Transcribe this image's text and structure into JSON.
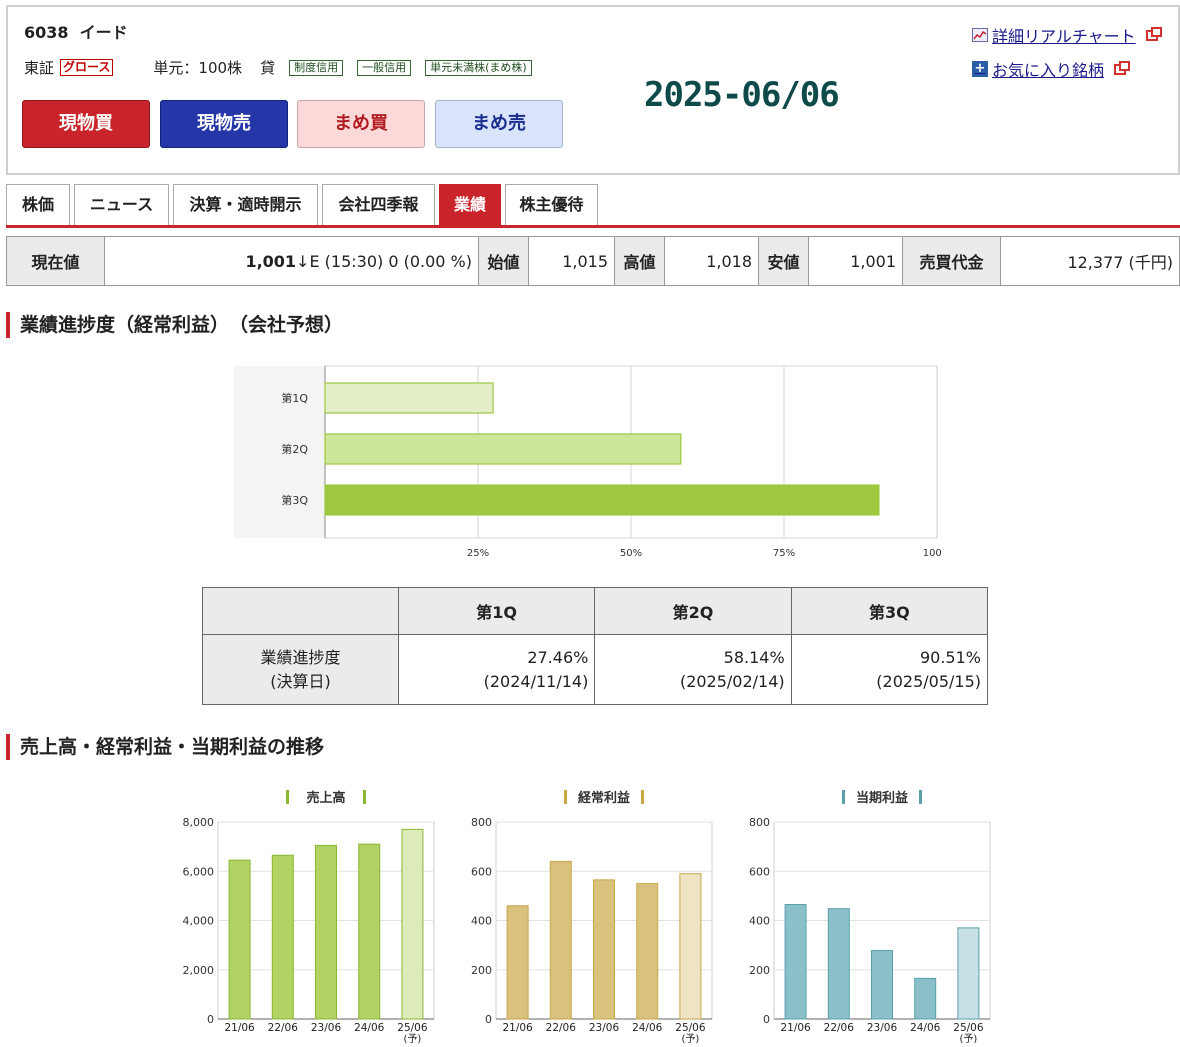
{
  "header": {
    "code": "6038",
    "name": "イード",
    "market": "東証",
    "market_badge": "グロース",
    "unit": "単元：100株",
    "kashi": "貸",
    "tags": [
      "制度信用",
      "一般信用",
      "単元未満株(まめ株)"
    ],
    "date": "2025-06/06",
    "links": [
      "詳細リアルチャート",
      "お気に入り銘柄"
    ],
    "buttons": [
      "現物買",
      "現物売",
      "まめ買",
      "まめ売"
    ]
  },
  "tabs": [
    {
      "label": "株価",
      "active": false
    },
    {
      "label": "ニュース",
      "active": false
    },
    {
      "label": "決算・適時開示",
      "active": false
    },
    {
      "label": "会社四季報",
      "active": false
    },
    {
      "label": "業績",
      "active": true
    },
    {
      "label": "株主優待",
      "active": false
    }
  ],
  "price": {
    "current_label": "現在値",
    "current_price": "1,001",
    "current_arrow": "↓",
    "current_detail": "E (15:30) 0 (0.00 %)",
    "open_label": "始値",
    "open": "1,015",
    "high_label": "高値",
    "high": "1,018",
    "low_label": "安値",
    "low": "1,001",
    "volume_label": "売買代金",
    "volume": "12,377 (千円)"
  },
  "sections": {
    "progress_title": "業績進捗度（経常利益）　（会社予想）",
    "trend_title": "売上高・経常利益・当期利益の推移"
  },
  "progress_table": {
    "headers": [
      "",
      "第1Q",
      "第2Q",
      "第3Q"
    ],
    "row_label": [
      "業績進捗度",
      "(決算日)"
    ],
    "values": [
      "27.46%",
      "58.14%",
      "90.51%"
    ],
    "dates": [
      "(2024/11/14)",
      "(2025/02/14)",
      "(2025/05/15)"
    ]
  },
  "chart_data": [
    {
      "type": "bar",
      "orientation": "horizontal",
      "categories": [
        "第1Q",
        "第2Q",
        "第3Q"
      ],
      "values": [
        27.46,
        58.14,
        90.51
      ],
      "xlim": [
        0,
        100
      ],
      "xticks": [
        "25%",
        "50%",
        "75%",
        "100%"
      ],
      "colors": [
        "#e2efc8",
        "#cde69c",
        "#9dc83f"
      ],
      "grid": true
    },
    {
      "type": "bar",
      "title": "売上高",
      "categories": [
        "21/06",
        "22/06",
        "23/06",
        "24/06",
        "25/06"
      ],
      "forecast_label": "(予)",
      "values": [
        6450,
        6650,
        7050,
        7100,
        7700
      ],
      "ylim": [
        0,
        8000
      ],
      "ytick_values": [
        0,
        2000,
        4000,
        6000,
        8000
      ],
      "yticks": [
        "0",
        "2,000",
        "4,000",
        "6,000",
        "8,000"
      ],
      "color": "#b2d263",
      "forecast_color": "#dcebb8",
      "accent": "#8ab832"
    },
    {
      "type": "bar",
      "title": "経常利益",
      "categories": [
        "21/06",
        "22/06",
        "23/06",
        "24/06",
        "25/06"
      ],
      "forecast_label": "(予)",
      "values": [
        460,
        640,
        565,
        550,
        590
      ],
      "ylim": [
        0,
        800
      ],
      "ytick_values": [
        0,
        200,
        400,
        600,
        800
      ],
      "yticks": [
        "0",
        "200",
        "400",
        "600",
        "800"
      ],
      "color": "#d8c27e",
      "forecast_color": "#eee3c2",
      "accent": "#c9a64a"
    },
    {
      "type": "bar",
      "title": "当期利益",
      "categories": [
        "21/06",
        "22/06",
        "23/06",
        "24/06",
        "25/06"
      ],
      "forecast_label": "(予)",
      "values": [
        465,
        448,
        278,
        165,
        370
      ],
      "ylim": [
        0,
        800
      ],
      "ytick_values": [
        0,
        200,
        400,
        600,
        800
      ],
      "yticks": [
        "0",
        "200",
        "400",
        "600",
        "800"
      ],
      "color": "#8cc0c8",
      "forecast_color": "#c6e0e4",
      "accent": "#5aa0ac"
    }
  ]
}
